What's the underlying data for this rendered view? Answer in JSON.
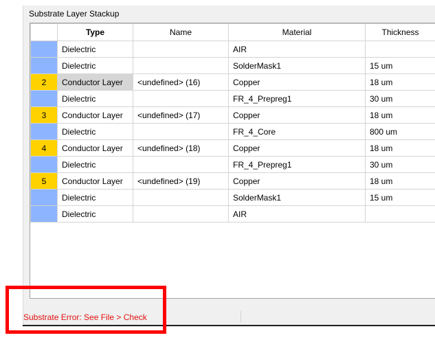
{
  "panel": {
    "title": "Substrate Layer Stackup"
  },
  "table": {
    "headers": {
      "index": "",
      "type": "Type",
      "name": "Name",
      "material": "Material",
      "thickness": "Thickness"
    },
    "rows": [
      {
        "index": "",
        "type": "Dielectric",
        "name": "",
        "material": "AIR",
        "thickness": "",
        "kind": "dielectric"
      },
      {
        "index": "",
        "type": "Dielectric",
        "name": "",
        "material": "SolderMask1",
        "thickness": "15 um",
        "kind": "dielectric"
      },
      {
        "index": "2",
        "type": "Conductor Layer",
        "name": "<undefined> (16)",
        "material": "Copper",
        "thickness": "18 um",
        "kind": "conductor",
        "selected": true
      },
      {
        "index": "",
        "type": "Dielectric",
        "name": "",
        "material": "FR_4_Prepreg1",
        "thickness": "30 um",
        "kind": "dielectric"
      },
      {
        "index": "3",
        "type": "Conductor Layer",
        "name": "<undefined> (17)",
        "material": "Copper",
        "thickness": "18 um",
        "kind": "conductor"
      },
      {
        "index": "",
        "type": "Dielectric",
        "name": "",
        "material": "FR_4_Core",
        "thickness": "800 um",
        "kind": "dielectric"
      },
      {
        "index": "4",
        "type": "Conductor Layer",
        "name": "<undefined> (18)",
        "material": "Copper",
        "thickness": "18 um",
        "kind": "conductor"
      },
      {
        "index": "",
        "type": "Dielectric",
        "name": "",
        "material": "FR_4_Prepreg1",
        "thickness": "30 um",
        "kind": "dielectric"
      },
      {
        "index": "5",
        "type": "Conductor Layer",
        "name": "<undefined> (19)",
        "material": "Copper",
        "thickness": "18 um",
        "kind": "conductor"
      },
      {
        "index": "",
        "type": "Dielectric",
        "name": "",
        "material": "SolderMask1",
        "thickness": "15 um",
        "kind": "dielectric"
      },
      {
        "index": "",
        "type": "Dielectric",
        "name": "",
        "material": "AIR",
        "thickness": "",
        "kind": "dielectric"
      }
    ]
  },
  "status": {
    "error_text": "Substrate Error: See File > Check"
  },
  "colors": {
    "dielectric": "#8db4ff",
    "conductor": "#ffd200",
    "error": "#e01010",
    "highlight": "#ff0000"
  }
}
